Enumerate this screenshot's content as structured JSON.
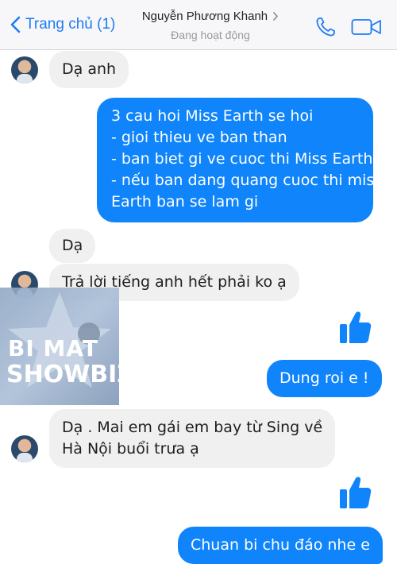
{
  "header": {
    "back_label": "Trang chủ (1)",
    "contact_name": "Nguyễn Phương Khanh",
    "status": "Đang hoạt động"
  },
  "messages": [
    {
      "side": "in",
      "lines": [
        "Dạ anh"
      ]
    },
    {
      "side": "out",
      "lines": [
        "3 cau hoi Miss Earth se hoi",
        "- gioi thieu ve ban than",
        "- ban biet gi ve cuoc thi Miss Earth",
        "- nếu ban dang quang cuoc thi mis",
        "Earth ban se lam gi"
      ]
    },
    {
      "side": "in",
      "lines": [
        "Dạ"
      ]
    },
    {
      "side": "in",
      "lines": [
        "Trả lời tiếng anh hết phải ko ạ"
      ]
    },
    {
      "side": "out",
      "type": "like"
    },
    {
      "side": "out",
      "lines": [
        "Dung roi e !"
      ]
    },
    {
      "side": "in",
      "lines": [
        "Dạ . Mai em gái em bay từ Sing về",
        "Hà Nội buổi trưa ạ"
      ]
    },
    {
      "side": "out",
      "type": "like"
    },
    {
      "side": "out",
      "lines": [
        "Chuan bi chu đáo nhe e"
      ]
    }
  ],
  "watermark": {
    "line1": "BI MAT",
    "line2": "SHOWBIZ"
  },
  "colors": {
    "accent": "#1e7cf2",
    "outgoing_bubble": "#0f84fb",
    "incoming_bubble": "#f0f0f0"
  },
  "icons": {
    "back": "chevron-left-icon",
    "name_chevron": "chevron-right-icon",
    "call": "phone-icon",
    "video": "video-camera-icon",
    "like": "thumbs-up-icon"
  }
}
